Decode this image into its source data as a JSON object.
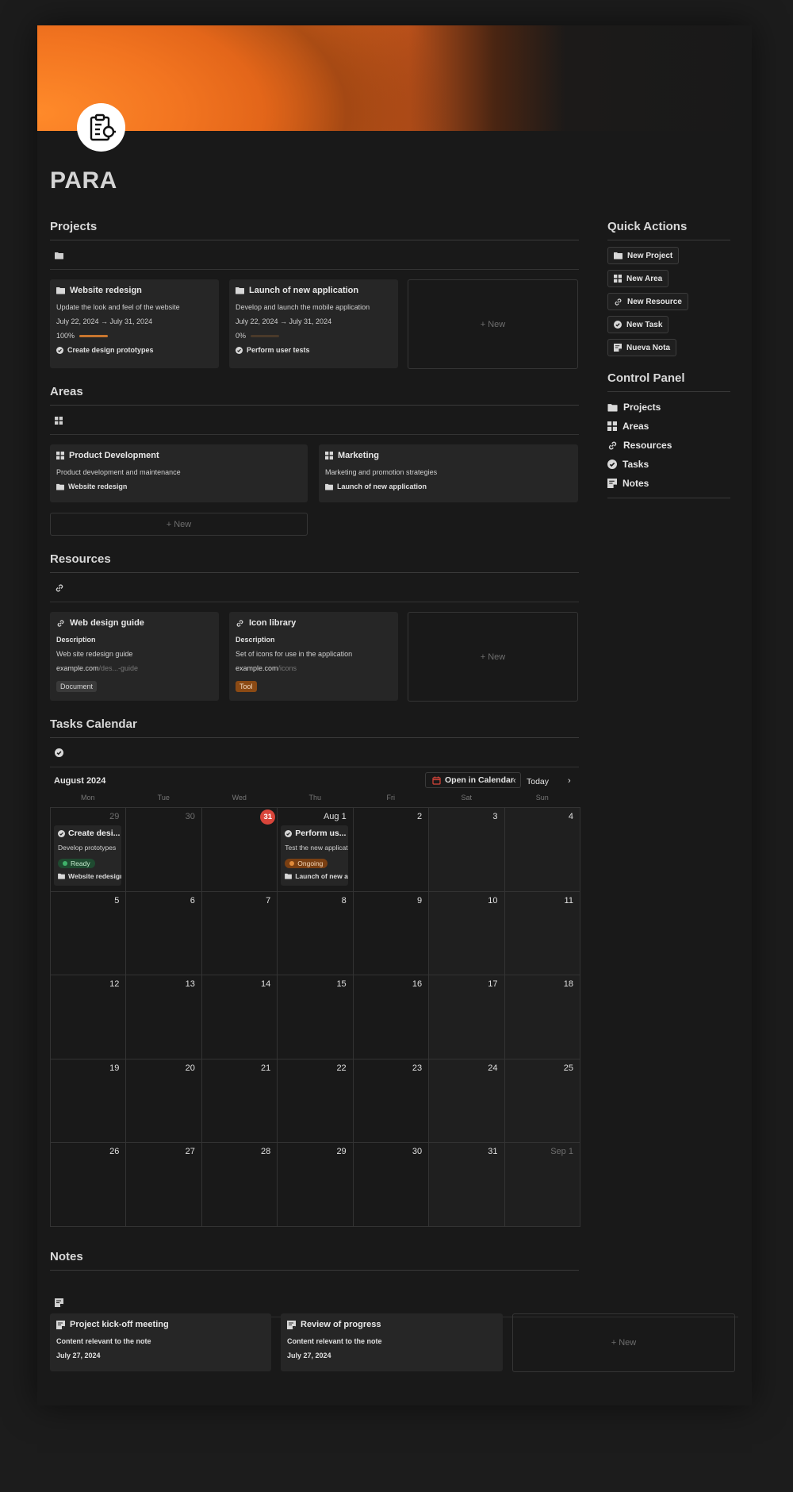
{
  "page": {
    "title": "PARA"
  },
  "projects": {
    "heading": "Projects",
    "cards": [
      {
        "title": "Website redesign",
        "description": "Update the look and feel of the website",
        "dates": "July 22, 2024 → July 31, 2024",
        "progress_label": "100%",
        "progress": 1.0,
        "task": "Create design prototypes"
      },
      {
        "title": "Launch of new application",
        "description": "Develop and launch the mobile application",
        "dates": "July 22, 2024 → July 31, 2024",
        "progress_label": "0%",
        "progress": 0.0,
        "task": "Perform user tests"
      }
    ],
    "new_label": "+ New"
  },
  "areas": {
    "heading": "Areas",
    "cards": [
      {
        "title": "Product Development",
        "description": "Product development and maintenance",
        "project": "Website redesign"
      },
      {
        "title": "Marketing",
        "description": "Marketing and promotion strategies",
        "project": "Launch of new application"
      }
    ],
    "new_label": "+ New"
  },
  "resources": {
    "heading": "Resources",
    "cards": [
      {
        "title": "Web design guide",
        "desc_label": "Description",
        "description": "Web site redesign guide",
        "url_main": "example.com",
        "url_rest": "/des...-guide",
        "tag": "Document"
      },
      {
        "title": "Icon library",
        "desc_label": "Description",
        "description": "Set of icons for use in the application",
        "url_main": "example.com",
        "url_rest": "/icons",
        "tag": "Tool"
      }
    ],
    "new_label": "+ New"
  },
  "quick_actions": {
    "heading": "Quick Actions",
    "buttons": [
      "New Project",
      "New Area",
      "New Resource",
      "New Task",
      "Nueva Nota"
    ]
  },
  "control_panel": {
    "heading": "Control Panel",
    "items": [
      "Projects",
      "Areas",
      "Resources",
      "Tasks",
      "Notes"
    ]
  },
  "calendar": {
    "heading": "Tasks Calendar",
    "month": "August 2024",
    "open_label": "Open in Calendar",
    "today_label": "Today",
    "weekdays": [
      "Mon",
      "Tue",
      "Wed",
      "Thu",
      "Fri",
      "Sat",
      "Sun"
    ],
    "weeks": [
      [
        "29",
        "30",
        "31",
        "Aug 1",
        "2",
        "3",
        "4"
      ],
      [
        "5",
        "6",
        "7",
        "8",
        "9",
        "10",
        "11"
      ],
      [
        "12",
        "13",
        "14",
        "15",
        "16",
        "17",
        "18"
      ],
      [
        "19",
        "20",
        "21",
        "22",
        "23",
        "24",
        "25"
      ],
      [
        "26",
        "27",
        "28",
        "29",
        "30",
        "31",
        "Sep 1"
      ]
    ],
    "events": [
      {
        "title": "Create desi...",
        "description": "Develop prototypes",
        "status": "Ready",
        "project": "Website redesign"
      },
      {
        "title": "Perform us...",
        "description": "Test the new application",
        "status": "Ongoing",
        "project": "Launch of new app"
      }
    ],
    "colors": {
      "today": "#d9453a",
      "ready": "#1f4a30",
      "ongoing": "#7a3f12"
    }
  },
  "notes": {
    "heading": "Notes",
    "cards": [
      {
        "title": "Project kick-off meeting",
        "content": "Content relevant to the note",
        "date": "July 27, 2024"
      },
      {
        "title": "Review of progress",
        "content": "Content relevant to the note",
        "date": "July 27, 2024"
      }
    ],
    "new_label": "+ New"
  }
}
